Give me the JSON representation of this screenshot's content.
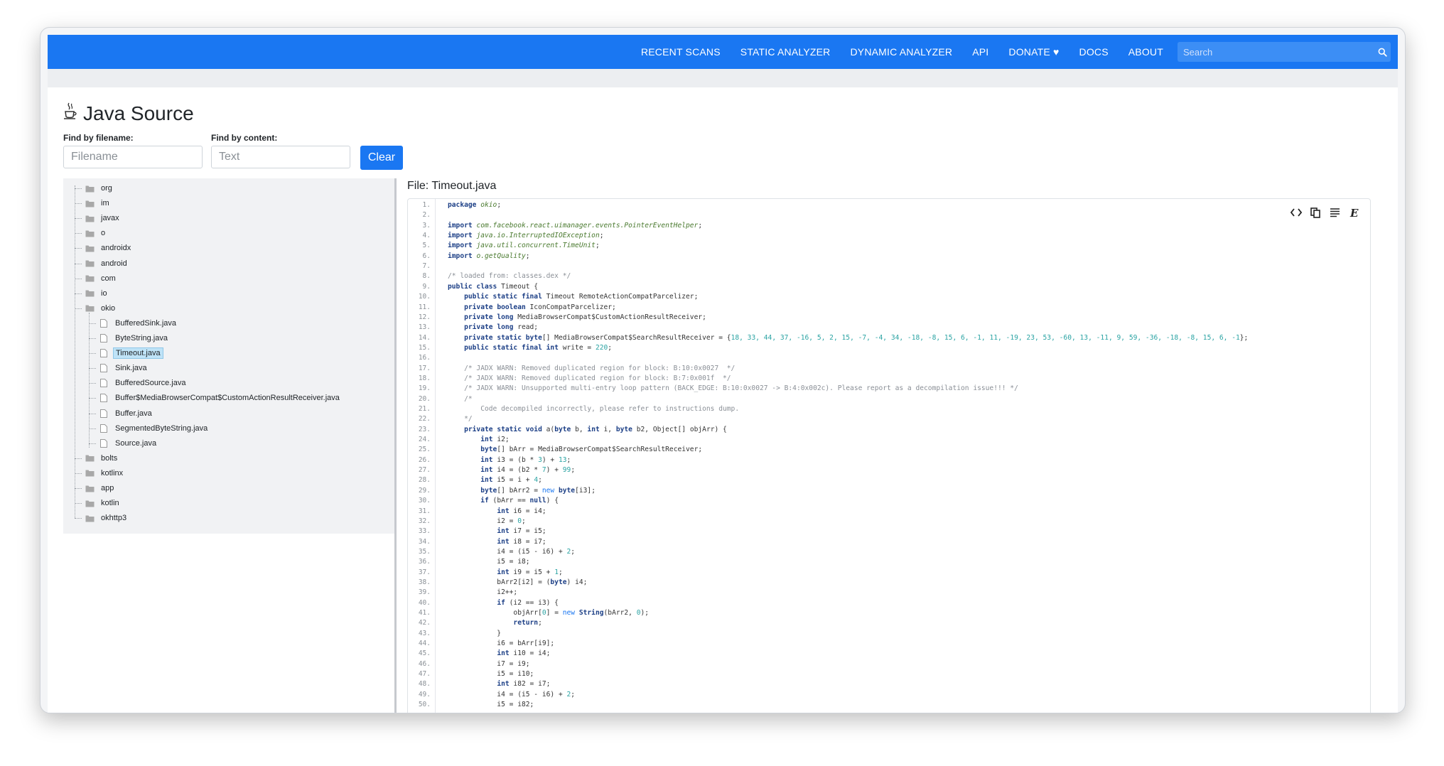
{
  "nav": {
    "links": [
      "RECENT SCANS",
      "STATIC ANALYZER",
      "DYNAMIC ANALYZER",
      "API",
      "DONATE ♥",
      "DOCS",
      "ABOUT"
    ],
    "search_placeholder": "Search",
    "color": "#1a77f2"
  },
  "page": {
    "title": "Java Source",
    "title_icon": "java-cup-icon"
  },
  "filters": {
    "filename_label": "Find by filename:",
    "filename_placeholder": "Filename",
    "content_label": "Find by content:",
    "content_placeholder": "Text",
    "clear_label": "Clear"
  },
  "tree": {
    "items": [
      {
        "label": "org",
        "type": "folder",
        "level": 0
      },
      {
        "label": "im",
        "type": "folder",
        "level": 0
      },
      {
        "label": "javax",
        "type": "folder",
        "level": 0
      },
      {
        "label": "o",
        "type": "folder",
        "level": 0
      },
      {
        "label": "androidx",
        "type": "folder",
        "level": 0
      },
      {
        "label": "android",
        "type": "folder",
        "level": 0
      },
      {
        "label": "com",
        "type": "folder",
        "level": 0
      },
      {
        "label": "io",
        "type": "folder",
        "level": 0
      },
      {
        "label": "okio",
        "type": "folder",
        "level": 0
      },
      {
        "label": "BufferedSink.java",
        "type": "file",
        "level": 1
      },
      {
        "label": "ByteString.java",
        "type": "file",
        "level": 1
      },
      {
        "label": "Timeout.java",
        "type": "file",
        "level": 1,
        "selected": true
      },
      {
        "label": "Sink.java",
        "type": "file",
        "level": 1
      },
      {
        "label": "BufferedSource.java",
        "type": "file",
        "level": 1
      },
      {
        "label": "Buffer$MediaBrowserCompat$CustomActionResultReceiver.java",
        "type": "file",
        "level": 1
      },
      {
        "label": "Buffer.java",
        "type": "file",
        "level": 1
      },
      {
        "label": "SegmentedByteString.java",
        "type": "file",
        "level": 1
      },
      {
        "label": "Source.java",
        "type": "file",
        "level": 1
      },
      {
        "label": "bolts",
        "type": "folder",
        "level": 0
      },
      {
        "label": "kotlinx",
        "type": "folder",
        "level": 0
      },
      {
        "label": "app",
        "type": "folder",
        "level": 0
      },
      {
        "label": "kotlin",
        "type": "folder",
        "level": 0
      },
      {
        "label": "okhttp3",
        "type": "folder",
        "level": 0
      }
    ]
  },
  "file": {
    "title": "File: Timeout.java",
    "tools": [
      "code-icon",
      "copy-icon",
      "wrap-lines-icon",
      "editor-icon"
    ],
    "lines": [
      [
        [
          "kw",
          "package "
        ],
        [
          "str",
          "okio"
        ],
        [
          "plain",
          ";"
        ]
      ],
      [],
      [
        [
          "kw",
          "import "
        ],
        [
          "str",
          "com.facebook.react.uimanager.events.PointerEventHelper"
        ],
        [
          "plain",
          ";"
        ]
      ],
      [
        [
          "kw",
          "import "
        ],
        [
          "str",
          "java.io.InterruptedIOException"
        ],
        [
          "plain",
          ";"
        ]
      ],
      [
        [
          "kw",
          "import "
        ],
        [
          "str",
          "java.util.concurrent.TimeUnit"
        ],
        [
          "plain",
          ";"
        ]
      ],
      [
        [
          "kw",
          "import "
        ],
        [
          "str",
          "o.getQuality"
        ],
        [
          "plain",
          ";"
        ]
      ],
      [],
      [
        [
          "cm",
          "/* loaded from: classes.dex */"
        ]
      ],
      [
        [
          "kw",
          "public class "
        ],
        [
          "plain",
          "Timeout {"
        ]
      ],
      [
        [
          "plain",
          "    "
        ],
        [
          "kw",
          "public static final "
        ],
        [
          "plain",
          "Timeout RemoteActionCompatParcelizer;"
        ]
      ],
      [
        [
          "plain",
          "    "
        ],
        [
          "kw",
          "private boolean "
        ],
        [
          "plain",
          "IconCompatParcelizer;"
        ]
      ],
      [
        [
          "plain",
          "    "
        ],
        [
          "kw",
          "private long "
        ],
        [
          "plain",
          "MediaBrowserCompat$CustomActionResultReceiver;"
        ]
      ],
      [
        [
          "plain",
          "    "
        ],
        [
          "kw",
          "private long "
        ],
        [
          "plain",
          "read;"
        ]
      ],
      [
        [
          "plain",
          "    "
        ],
        [
          "kw",
          "private static byte"
        ],
        [
          "plain",
          "[] MediaBrowserCompat$SearchResultReceiver = {"
        ],
        [
          "num",
          "18, 33, 44, 37, -16, 5, 2, 15, -7, -4, 34, -18, -8, 15, 6, -1, 11, -19, 23, 53, -60, 13, -11, 9, 59, -36, -18, -8, 15, 6, -1"
        ],
        [
          "plain",
          "};"
        ]
      ],
      [
        [
          "plain",
          "    "
        ],
        [
          "kw",
          "public static final int "
        ],
        [
          "plain",
          "write = "
        ],
        [
          "num",
          "220"
        ],
        [
          "plain",
          ";"
        ]
      ],
      [],
      [
        [
          "plain",
          "    "
        ],
        [
          "cm",
          "/* JADX WARN: Removed duplicated region for block: B:10:0x0027  */"
        ]
      ],
      [
        [
          "plain",
          "    "
        ],
        [
          "cm",
          "/* JADX WARN: Removed duplicated region for block: B:7:0x001f  */"
        ]
      ],
      [
        [
          "plain",
          "    "
        ],
        [
          "cm",
          "/* JADX WARN: Unsupported multi-entry loop pattern (BACK_EDGE: B:10:0x0027 -> B:4:0x002c). Please report as a decompilation issue!!! */"
        ]
      ],
      [
        [
          "plain",
          "    "
        ],
        [
          "cm",
          "/*"
        ]
      ],
      [
        [
          "plain",
          "        "
        ],
        [
          "cm",
          "Code decompiled incorrectly, please refer to instructions dump."
        ]
      ],
      [
        [
          "plain",
          "    "
        ],
        [
          "cm",
          "*/"
        ]
      ],
      [
        [
          "plain",
          "    "
        ],
        [
          "kw",
          "private static void "
        ],
        [
          "plain",
          "a("
        ],
        [
          "kw",
          "byte "
        ],
        [
          "plain",
          "b, "
        ],
        [
          "kw",
          "int "
        ],
        [
          "plain",
          "i, "
        ],
        [
          "kw",
          "byte "
        ],
        [
          "plain",
          "b2, Object[] objArr) {"
        ]
      ],
      [
        [
          "plain",
          "        "
        ],
        [
          "kw",
          "int "
        ],
        [
          "plain",
          "i2;"
        ]
      ],
      [
        [
          "plain",
          "        "
        ],
        [
          "kw",
          "byte"
        ],
        [
          "plain",
          "[] bArr = MediaBrowserCompat$SearchResultReceiver;"
        ]
      ],
      [
        [
          "plain",
          "        "
        ],
        [
          "kw",
          "int "
        ],
        [
          "plain",
          "i3 = (b * "
        ],
        [
          "num",
          "3"
        ],
        [
          "plain",
          ") + "
        ],
        [
          "num",
          "13"
        ],
        [
          "plain",
          ";"
        ]
      ],
      [
        [
          "plain",
          "        "
        ],
        [
          "kw",
          "int "
        ],
        [
          "plain",
          "i4 = (b2 * "
        ],
        [
          "num",
          "7"
        ],
        [
          "plain",
          ") + "
        ],
        [
          "num",
          "99"
        ],
        [
          "plain",
          ";"
        ]
      ],
      [
        [
          "plain",
          "        "
        ],
        [
          "kw",
          "int "
        ],
        [
          "plain",
          "i5 = i + "
        ],
        [
          "num",
          "4"
        ],
        [
          "plain",
          ";"
        ]
      ],
      [
        [
          "plain",
          "        "
        ],
        [
          "kw",
          "byte"
        ],
        [
          "plain",
          "[] bArr2 = "
        ],
        [
          "kwn",
          "new "
        ],
        [
          "kw",
          "byte"
        ],
        [
          "plain",
          "[i3];"
        ]
      ],
      [
        [
          "plain",
          "        "
        ],
        [
          "kw",
          "if "
        ],
        [
          "plain",
          "(bArr == "
        ],
        [
          "kw",
          "null"
        ],
        [
          "plain",
          ") {"
        ]
      ],
      [
        [
          "plain",
          "            "
        ],
        [
          "kw",
          "int "
        ],
        [
          "plain",
          "i6 = i4;"
        ]
      ],
      [
        [
          "plain",
          "            i2 = "
        ],
        [
          "num",
          "0"
        ],
        [
          "plain",
          ";"
        ]
      ],
      [
        [
          "plain",
          "            "
        ],
        [
          "kw",
          "int "
        ],
        [
          "plain",
          "i7 = i5;"
        ]
      ],
      [
        [
          "plain",
          "            "
        ],
        [
          "kw",
          "int "
        ],
        [
          "plain",
          "i8 = i7;"
        ]
      ],
      [
        [
          "plain",
          "            i4 = (i5 - i6) + "
        ],
        [
          "num",
          "2"
        ],
        [
          "plain",
          ";"
        ]
      ],
      [
        [
          "plain",
          "            i5 = i8;"
        ]
      ],
      [
        [
          "plain",
          "            "
        ],
        [
          "kw",
          "int "
        ],
        [
          "plain",
          "i9 = i5 + "
        ],
        [
          "num",
          "1"
        ],
        [
          "plain",
          ";"
        ]
      ],
      [
        [
          "plain",
          "            bArr2[i2] = ("
        ],
        [
          "kw",
          "byte"
        ],
        [
          "plain",
          ") i4;"
        ]
      ],
      [
        [
          "plain",
          "            i2++;"
        ]
      ],
      [
        [
          "plain",
          "            "
        ],
        [
          "kw",
          "if "
        ],
        [
          "plain",
          "(i2 == i3) {"
        ]
      ],
      [
        [
          "plain",
          "                objArr["
        ],
        [
          "num",
          "0"
        ],
        [
          "plain",
          "] = "
        ],
        [
          "kwn",
          "new "
        ],
        [
          "kw",
          "String"
        ],
        [
          "plain",
          "(bArr2, "
        ],
        [
          "num",
          "0"
        ],
        [
          "plain",
          ");"
        ]
      ],
      [
        [
          "plain",
          "                "
        ],
        [
          "kw",
          "return"
        ],
        [
          "plain",
          ";"
        ]
      ],
      [
        [
          "plain",
          "            }"
        ]
      ],
      [
        [
          "plain",
          "            i6 = bArr[i9];"
        ]
      ],
      [
        [
          "plain",
          "            "
        ],
        [
          "kw",
          "int "
        ],
        [
          "plain",
          "i10 = i4;"
        ]
      ],
      [
        [
          "plain",
          "            i7 = i9;"
        ]
      ],
      [
        [
          "plain",
          "            i5 = i10;"
        ]
      ],
      [
        [
          "plain",
          "            "
        ],
        [
          "kw",
          "int "
        ],
        [
          "plain",
          "i82 = i7;"
        ]
      ],
      [
        [
          "plain",
          "            i4 = (i5 - i6) + "
        ],
        [
          "num",
          "2"
        ],
        [
          "plain",
          ";"
        ]
      ],
      [
        [
          "plain",
          "            i5 = i82;"
        ]
      ]
    ]
  }
}
